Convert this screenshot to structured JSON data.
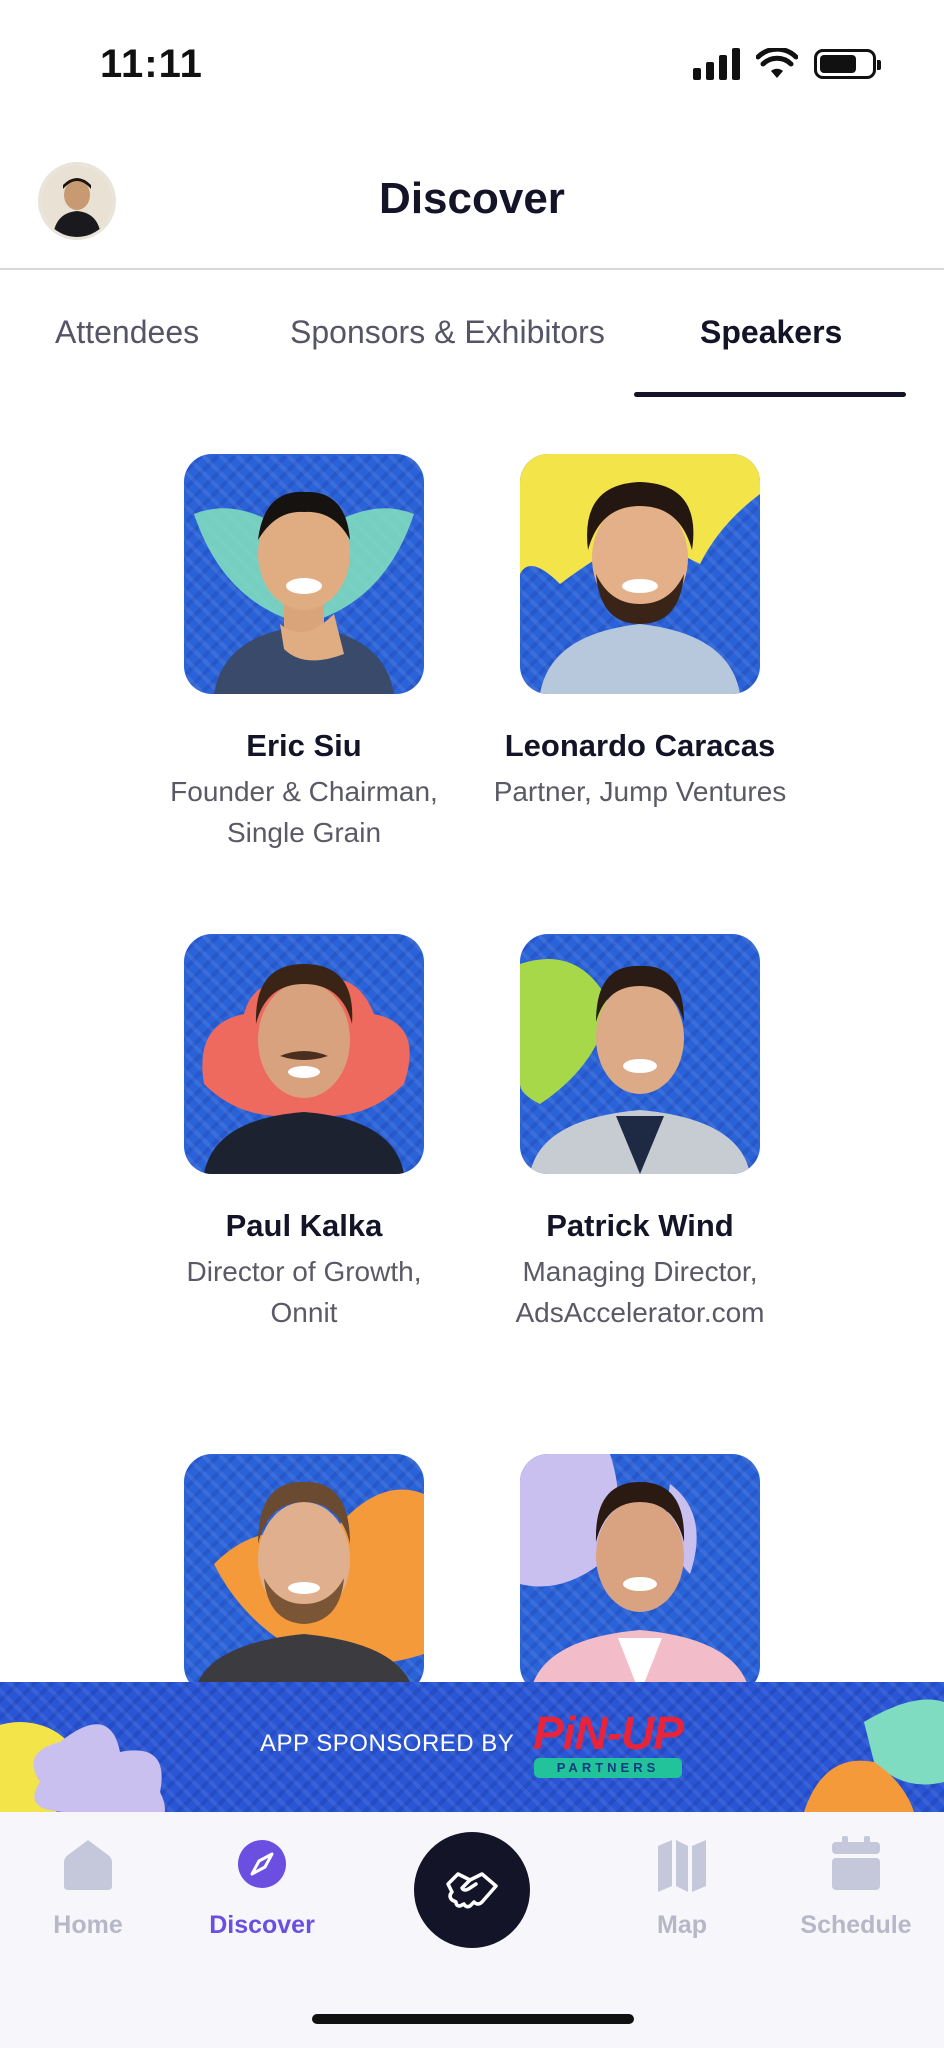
{
  "status_bar": {
    "time": "11:11",
    "signal_icon": "cellular-signal-icon",
    "wifi_icon": "wifi-icon",
    "battery_icon": "battery-icon",
    "battery_level": 0.72
  },
  "header": {
    "title": "Discover",
    "avatar_icon": "profile-avatar"
  },
  "tabs": [
    {
      "label": "Attendees",
      "active": false
    },
    {
      "label": "Sponsors & Exhibitors",
      "active": false
    },
    {
      "label": "Speakers",
      "active": true
    }
  ],
  "speakers": [
    {
      "name": "Eric Siu",
      "role": "Founder & Chairman, Single Grain"
    },
    {
      "name": "Leonardo Caracas",
      "role": "Partner, Jump Ventures"
    },
    {
      "name": "Paul Kalka",
      "role": "Director of Growth, Onnit"
    },
    {
      "name": "Patrick Wind",
      "role": "Managing Director, AdsAccelerator.com"
    },
    {
      "name": "",
      "role": ""
    },
    {
      "name": "",
      "role": ""
    }
  ],
  "sponsor_banner": {
    "text": "APP SPONSORED BY",
    "logo_word": "PiN-UP",
    "logo_sub": "PARTNERS"
  },
  "bottom_nav": {
    "items": [
      {
        "label": "Home",
        "icon": "home-icon",
        "active": false
      },
      {
        "label": "Discover",
        "icon": "compass-icon",
        "active": true
      },
      {
        "label": "Map",
        "icon": "map-icon",
        "active": false
      },
      {
        "label": "Schedule",
        "icon": "calendar-icon",
        "active": false
      }
    ],
    "center_icon": "handshake-icon"
  },
  "colors": {
    "accent": "#6a4fe0",
    "text_dark": "#141428",
    "banner_blue": "#2a56d6",
    "photo_blue": "#2a62d8",
    "inactive_nav": "#b6b8c8"
  }
}
